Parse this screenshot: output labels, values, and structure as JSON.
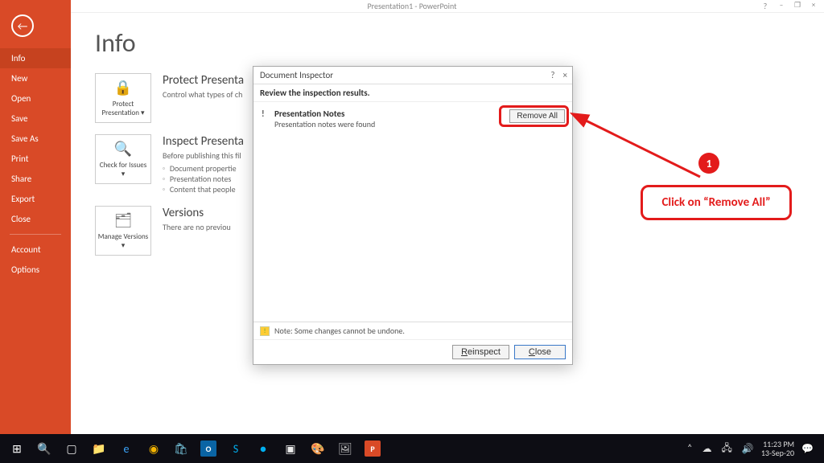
{
  "titlebar": {
    "title": "Presentation1 - PowerPoint"
  },
  "windowcontrols": {
    "help": "?",
    "min": "–",
    "restore": "❐",
    "close": "×"
  },
  "filemenu": {
    "items": [
      {
        "name": "info",
        "label": "Info",
        "selected": true
      },
      {
        "name": "new",
        "label": "New",
        "selected": false
      },
      {
        "name": "open",
        "label": "Open",
        "selected": false
      },
      {
        "name": "save",
        "label": "Save",
        "selected": false
      },
      {
        "name": "saveas",
        "label": "Save As",
        "selected": false
      },
      {
        "name": "print",
        "label": "Print",
        "selected": false
      },
      {
        "name": "share",
        "label": "Share",
        "selected": false
      },
      {
        "name": "export",
        "label": "Export",
        "selected": false
      },
      {
        "name": "close",
        "label": "Close",
        "selected": false
      }
    ],
    "footer": [
      {
        "name": "account",
        "label": "Account"
      },
      {
        "name": "options",
        "label": "Options"
      }
    ]
  },
  "page": {
    "title": "Info"
  },
  "sections": {
    "protect": {
      "tile": "Protect Presentation ▾",
      "heading": "Protect Presenta",
      "sub": "Control what types of ch"
    },
    "inspect": {
      "tile": "Check for Issues ▾",
      "heading": "Inspect Presenta",
      "sub": "Before publishing this fil",
      "bul1": "Document propertie",
      "bul2": "Presentation notes",
      "bul3": "Content that people"
    },
    "versions": {
      "tile": "Manage Versions ▾",
      "heading": "Versions",
      "sub": "There are no previou"
    }
  },
  "dialog": {
    "title": "Document Inspector",
    "subtitle": "Review the inspection results.",
    "result": {
      "mark": "!",
      "title": "Presentation Notes",
      "desc": "Presentation notes were found"
    },
    "remove_all": "Remove All",
    "note": "Note: Some changes cannot be undone.",
    "reinspect": "Reinspect",
    "close": "Close",
    "help": "?",
    "x": "×"
  },
  "annotation": {
    "badge": "1",
    "callout": "Click on “Remove All”"
  },
  "taskbar": {
    "clock_time": "11:23 PM",
    "clock_date": "13-Sep-20"
  }
}
